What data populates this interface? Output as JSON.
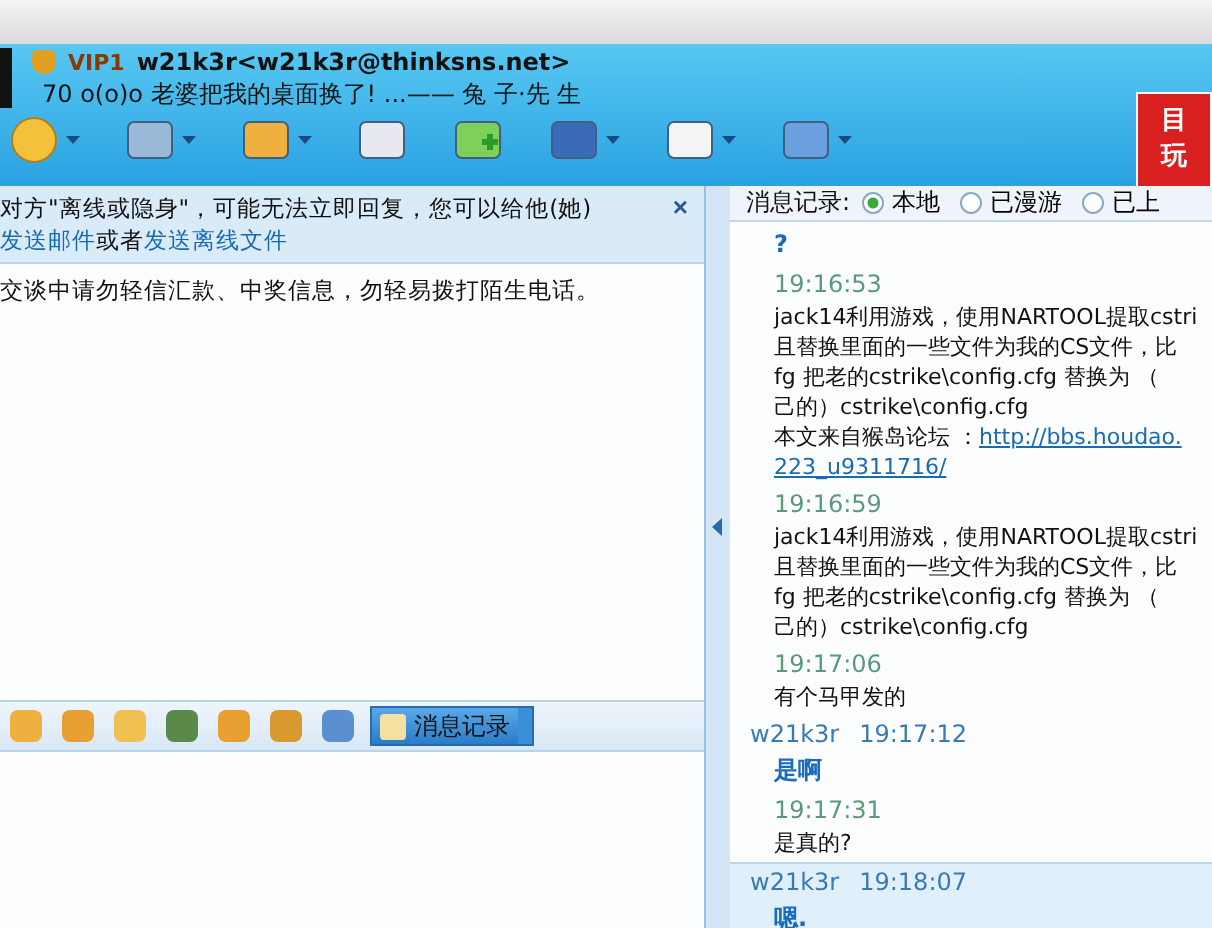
{
  "header": {
    "vip": "VIP1",
    "contact": "w21k3r<w21k3r@thinksns.net>",
    "signature": "70 o(o)o 老婆把我的桌面换了! ...—— 兔 子·先 生",
    "badge": [
      "目",
      "玩"
    ]
  },
  "notice": {
    "parts": [
      {
        "text": "对方\"离线或隐身\"，可能无法立即回复，您可以给他(她)",
        "link": false
      },
      {
        "text": "发送邮件",
        "link": true
      },
      {
        "text": "或者",
        "link": false
      },
      {
        "text": "发送离线文件",
        "link": true
      }
    ],
    "close": "×"
  },
  "warning": "交谈中请勿轻信汇款、中奖信息，勿轻易拨打陌生电话。",
  "history_button": "消息记录",
  "history": {
    "label": "消息记录:",
    "options": [
      {
        "label": "本地",
        "selected": true
      },
      {
        "label": "已漫游",
        "selected": false
      },
      {
        "label": "已上",
        "selected": false
      }
    ]
  },
  "messages": [
    {
      "own": true,
      "highlighted": false,
      "lines": [
        {
          "text": "?"
        }
      ]
    },
    {
      "own": false,
      "highlighted": false,
      "time": "19:16:53",
      "lines": [
        {
          "text": "jack14利用游戏，使用NARTOOL提取cstri"
        },
        {
          "text": "且替换里面的一些文件为我的CS文件，比"
        },
        {
          "text": "fg 把老的cstrike\\config.cfg 替换为 （"
        },
        {
          "text": "己的）cstrike\\config.cfg"
        },
        {
          "text": "本文来自猴岛论坛 ：",
          "link": "http://bbs.houdao."
        },
        {
          "link": "223_u9311716/"
        }
      ]
    },
    {
      "own": false,
      "highlighted": false,
      "time": "19:16:59",
      "lines": [
        {
          "text": "jack14利用游戏，使用NARTOOL提取cstri"
        },
        {
          "text": "且替换里面的一些文件为我的CS文件，比"
        },
        {
          "text": "fg 把老的cstrike\\config.cfg 替换为 （"
        },
        {
          "text": "己的）cstrike\\config.cfg"
        }
      ]
    },
    {
      "own": false,
      "highlighted": false,
      "time": "19:17:06",
      "lines": [
        {
          "text": "有个马甲发的"
        }
      ]
    },
    {
      "own": true,
      "highlighted": false,
      "sender": "w21k3r",
      "time": "19:17:12",
      "lines": [
        {
          "text": "是啊"
        }
      ]
    },
    {
      "own": false,
      "highlighted": false,
      "time": "19:17:31",
      "lines": [
        {
          "text": "是真的?"
        }
      ]
    },
    {
      "own": true,
      "highlighted": true,
      "sender": "w21k3r",
      "time": "19:18:07",
      "lines": [
        {
          "text": "嗯."
        }
      ]
    }
  ]
}
